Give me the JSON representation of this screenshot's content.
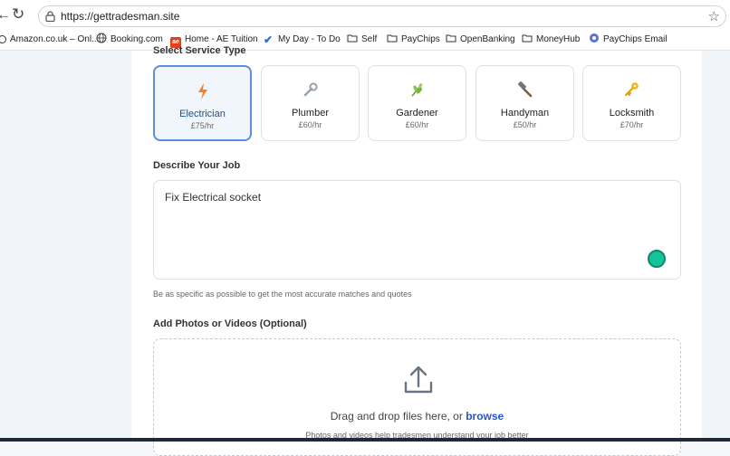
{
  "browser": {
    "url": "https://gettradesman.site",
    "bookmarks": [
      {
        "label": "Amazon.co.uk – Onl...",
        "icon": "amazon-icon"
      },
      {
        "label": "Booking.com",
        "icon": "globe-icon"
      },
      {
        "label": "Home - AE Tuition",
        "icon": "ae-tuition-icon"
      },
      {
        "label": "My Day - To Do",
        "icon": "checkmark-icon"
      },
      {
        "label": "Self",
        "icon": "folder-icon"
      },
      {
        "label": "PayChips",
        "icon": "folder-icon"
      },
      {
        "label": "OpenBanking",
        "icon": "folder-icon"
      },
      {
        "label": "MoneyHub",
        "icon": "folder-icon"
      },
      {
        "label": "PayChips Email",
        "icon": "paychips-icon"
      }
    ]
  },
  "form": {
    "service_section_label": "Select Service Type",
    "services": [
      {
        "name": "Electrician",
        "price": "£75/hr",
        "icon": "lightning-icon",
        "emoji": "⚡",
        "selected": true
      },
      {
        "name": "Plumber",
        "price": "£60/hr",
        "icon": "wrench-icon",
        "emoji": "🔧",
        "selected": false
      },
      {
        "name": "Gardener",
        "price": "£60/hr",
        "icon": "herb-icon",
        "emoji": "🌿",
        "selected": false
      },
      {
        "name": "Handyman",
        "price": "£50/hr",
        "icon": "hammer-icon",
        "emoji": "🔨",
        "selected": false
      },
      {
        "name": "Locksmith",
        "price": "£70/hr",
        "icon": "key-icon",
        "emoji": "🔑",
        "selected": false
      }
    ],
    "describe_label": "Describe Your Job",
    "job_description": "Fix Electrical socket",
    "helper_text": "Be as specific as possible to get the most accurate matches and quotes",
    "photos_label": "Add Photos or Videos (Optional)",
    "drop_text": "Drag and drop files here, or",
    "browse_label": "browse",
    "drop_hint": "Photos and videos help tradesmen understand your job better"
  },
  "colors": {
    "accent": "#2456c9",
    "selected_border": "#5b8fd6",
    "grammarly": "#15c39a"
  }
}
